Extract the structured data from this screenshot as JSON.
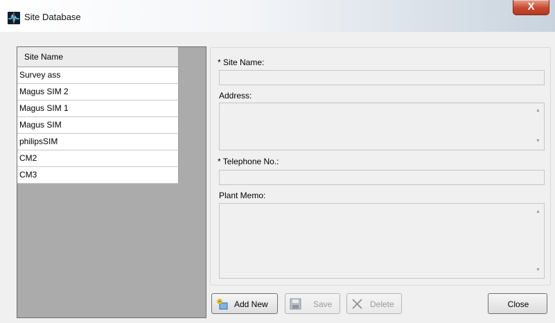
{
  "window": {
    "title": "Site Database",
    "close_glyph": "X"
  },
  "grid": {
    "header": "Site Name",
    "rows": [
      "Survey ass",
      "Magus SIM 2",
      "Magus SIM 1",
      "Magus SIM",
      "philipsSIM",
      "CM2",
      "CM3"
    ]
  },
  "form": {
    "site_name_label": "* Site Name:",
    "site_name_value": "",
    "address_label": "Address:",
    "address_value": "",
    "telephone_label": "* Telephone No.:",
    "telephone_value": "",
    "plant_memo_label": "Plant Memo:",
    "plant_memo_value": ""
  },
  "buttons": {
    "add_new": "Add New",
    "save": "Save",
    "delete": "Delete",
    "close": "Close"
  },
  "icons": {
    "app": "app-waveform-icon",
    "add_new": "add-new-icon",
    "save": "floppy-disk-icon",
    "delete": "x-delete-icon"
  },
  "colors": {
    "grid_background": "#ababab",
    "close_button_red": "#c8482f"
  }
}
